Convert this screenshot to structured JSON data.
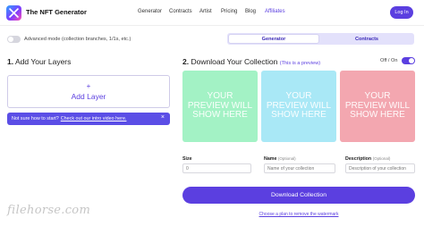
{
  "header": {
    "brand": "The NFT Generator",
    "nav": [
      "Generator",
      "Contracts",
      "Artist",
      "Pricing",
      "Blog",
      "Affiliates"
    ],
    "login_label": "Log In",
    "accent": "#5b3fe0"
  },
  "advanced": {
    "label": "Advanced mode (collection branches, 1/1s, etc.)",
    "enabled": false
  },
  "mode_tabs": {
    "active": "Generator",
    "other": "Contracts"
  },
  "layers": {
    "number": "1.",
    "title": "Add Your Layers",
    "plus": "+",
    "add_label": "Add Layer",
    "tip_text": "Not sure how to start?",
    "tip_link": "Check out our intro video here.",
    "tip_close": "×"
  },
  "download": {
    "number": "2.",
    "title": "Download Your Collection",
    "subtitle": "(This is a preview)",
    "toggle_label": "Off / On",
    "toggle_on": true,
    "preview_text": "YOUR PREVIEW WILL SHOW HERE",
    "preview_colors": [
      "#a3f2c5",
      "#a9e8f6",
      "#f3a7b0"
    ],
    "size_label": "Size",
    "size_value": "0",
    "name_label": "Name",
    "name_optional": "(Optional)",
    "name_placeholder": "Name of your collection",
    "desc_label": "Description",
    "desc_optional": "(Optional)",
    "desc_placeholder": "Description of your collection",
    "button_label": "Download Collection",
    "remove_watermark": "Choose a plan to remove the watermark"
  },
  "watermark": "filehorse.com"
}
